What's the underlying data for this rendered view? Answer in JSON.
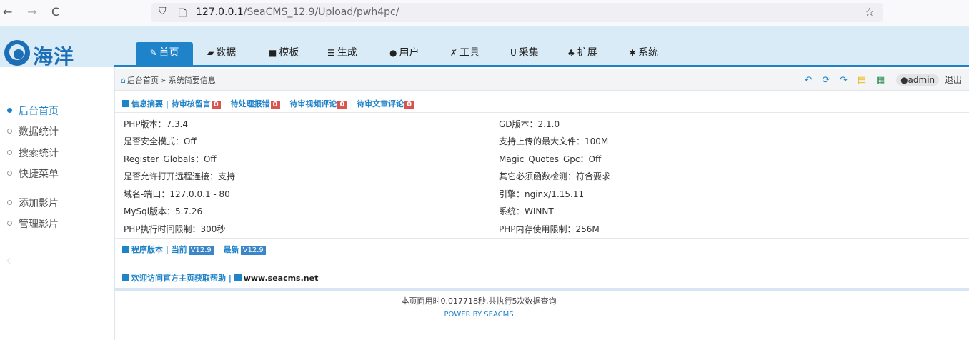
{
  "browser": {
    "back": "←",
    "forward": "→",
    "reload": "C",
    "url_host": "127.0.0.1",
    "url_path": "/SeaCMS_12.9/Upload/pwh4pc/",
    "star": "☆"
  },
  "logo": {
    "text": "海洋"
  },
  "tabs": [
    {
      "label": "首页",
      "icon": "edit-icon"
    },
    {
      "label": "数据",
      "icon": "database-icon"
    },
    {
      "label": "模板",
      "icon": "file-icon"
    },
    {
      "label": "生成",
      "icon": "server-icon"
    },
    {
      "label": "用户",
      "icon": "user-icon"
    },
    {
      "label": "工具",
      "icon": "wrench-icon"
    },
    {
      "label": "采集",
      "icon": "magnet-icon"
    },
    {
      "label": "扩展",
      "icon": "sitemap-icon"
    },
    {
      "label": "系统",
      "icon": "gear-icon"
    }
  ],
  "sidebar": {
    "items": [
      {
        "label": "后台首页"
      },
      {
        "label": "数据统计"
      },
      {
        "label": "搜索统计"
      },
      {
        "label": "快捷菜单"
      },
      {
        "label": "添加影片"
      },
      {
        "label": "管理影片"
      }
    ]
  },
  "breadcrumb": {
    "text": "后台首页 » 系统简要信息"
  },
  "topbar": {
    "admin": "admin",
    "logout": "退出"
  },
  "summary": {
    "title": "信息摘要",
    "sep": "|",
    "links": [
      {
        "label": "待审核留言",
        "count": "0"
      },
      {
        "label": "待处理报错",
        "count": "0"
      },
      {
        "label": "待审视频评论",
        "count": "0"
      },
      {
        "label": "待审文章评论",
        "count": "0"
      }
    ]
  },
  "info": [
    {
      "left": "PHP版本：7.3.4",
      "right": "GD版本：2.1.0"
    },
    {
      "left": "是否安全模式：Off",
      "right": "支持上传的最大文件：100M"
    },
    {
      "left": "Register_Globals：Off",
      "right": "Magic_Quotes_Gpc：Off"
    },
    {
      "left": "是否允许打开远程连接：支持",
      "right": "其它必须函数检测：符合要求"
    },
    {
      "left": "域名-端口：127.0.0.1 - 80",
      "right": "引擎：nginx/1.15.11"
    },
    {
      "left": "MySql版本：5.7.26",
      "right": "系统：WINNT"
    },
    {
      "left": "PHP执行时间限制：300秒",
      "right": "PHP内存使用限制：256M"
    }
  ],
  "version": {
    "title": "程序版本",
    "current_label": "当前",
    "current": "V12.9",
    "latest_label": "最新",
    "latest": "V12.9"
  },
  "help": {
    "text": "欢迎访问官方主页获取帮助",
    "site": "www.seacms.net"
  },
  "footer": {
    "time": "本页面用时0.017718秒,共执行5次数据查询",
    "power": "POWER BY SEACMS"
  }
}
